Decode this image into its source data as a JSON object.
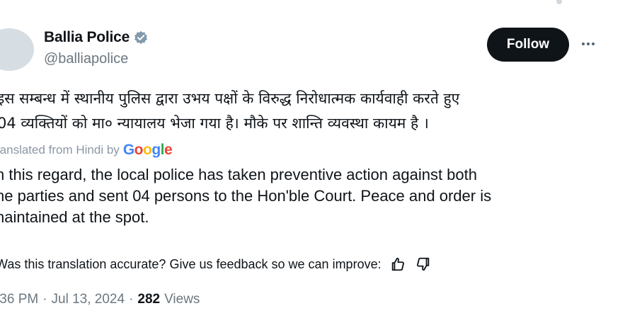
{
  "tweet": {
    "author": {
      "name": "Ballia Police",
      "handle": "@balliapolice"
    },
    "follow_label": "Follow",
    "original_text": [
      "इस सम्बन्ध में स्थानीय पुलिस द्वारा उभय पक्षों के विरुद्ध निरोधात्मक कार्यवाही करते हुए",
      "04 व्यक्तियों को मा० न्यायालय भेजा गया है। मौके पर शान्ति व्यवस्था कायम है ।"
    ],
    "translated_from": "ranslated from Hindi by",
    "translator": "Google",
    "translation_text": [
      "n this regard, the local police has taken preventive action against both",
      "he parties and sent 04 persons to the Hon'ble Court. Peace and order is",
      "naintained at the spot."
    ],
    "feedback_prompt": "Was this translation accurate? Give us feedback so we can improve:",
    "time": ":36 PM",
    "separator": "·",
    "date": "Jul 13, 2024",
    "views_count": "282",
    "views_label": "Views"
  },
  "icons": {
    "verified": "verified-badge-icon",
    "more": "more-options-icon",
    "thumbs_up": "thumbs-up-icon",
    "thumbs_down": "thumbs-down-icon"
  },
  "colors": {
    "text": "#0f1419",
    "secondary": "#6b7780",
    "follow_bg": "#0f1419",
    "google_blue": "#4285f4",
    "google_red": "#ea4335",
    "google_yellow": "#fbbc05",
    "google_green": "#34a853"
  }
}
